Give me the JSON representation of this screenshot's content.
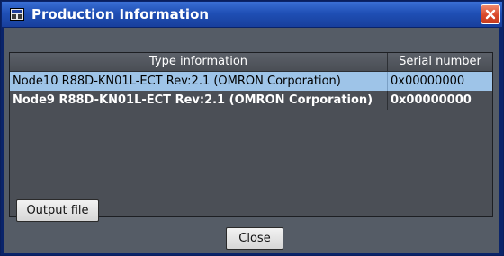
{
  "window": {
    "title": "Production Information",
    "title_icon": "window-icon",
    "close_icon": "close-x-icon"
  },
  "table": {
    "columns": [
      "Type information",
      "Serial number"
    ],
    "rows": [
      {
        "type": "Node10 R88D-KN01L-ECT Rev:2.1 (OMRON Corporation)",
        "serial": "0x00000000",
        "selected": true
      },
      {
        "type": "Node9 R88D-KN01L-ECT Rev:2.1 (OMRON Corporation)",
        "serial": "0x00000000",
        "selected": false
      }
    ]
  },
  "buttons": {
    "output_file": "Output file",
    "close": "Close"
  },
  "colors": {
    "titlebar": "#1f4fb5",
    "panel": "#555c66",
    "selected_row": "#9ec4e8",
    "close_button": "#d9482a"
  }
}
